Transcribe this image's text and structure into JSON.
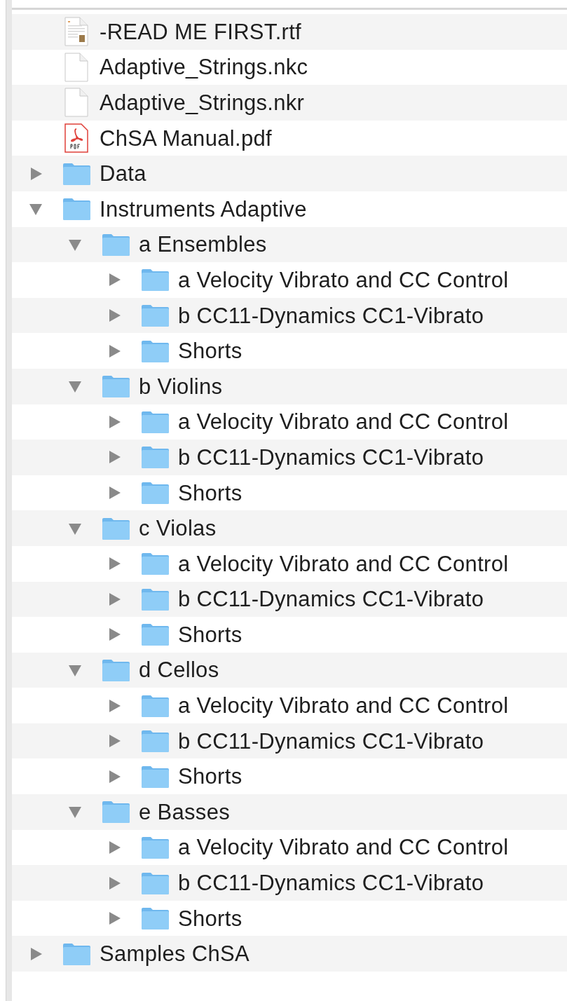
{
  "items": [
    {
      "kind": "rtf",
      "name": "-READ ME FIRST.rtf"
    },
    {
      "kind": "file",
      "name": "Adaptive_Strings.nkc"
    },
    {
      "kind": "file",
      "name": "Adaptive_Strings.nkr"
    },
    {
      "kind": "pdf",
      "name": "ChSA Manual.pdf"
    },
    {
      "kind": "folder",
      "name": "Data",
      "expanded": false
    },
    {
      "kind": "folder",
      "name": "Instruments Adaptive",
      "expanded": true,
      "children": [
        {
          "kind": "folder",
          "name": "a Ensembles",
          "expanded": true,
          "children": [
            {
              "kind": "folder",
              "name": "a Velocity Vibrato and CC Control",
              "expanded": false
            },
            {
              "kind": "folder",
              "name": "b CC11-Dynamics CC1-Vibrato",
              "expanded": false
            },
            {
              "kind": "folder",
              "name": "Shorts",
              "expanded": false
            }
          ]
        },
        {
          "kind": "folder",
          "name": "b Violins",
          "expanded": true,
          "children": [
            {
              "kind": "folder",
              "name": "a Velocity Vibrato and CC Control",
              "expanded": false
            },
            {
              "kind": "folder",
              "name": "b CC11-Dynamics CC1-Vibrato",
              "expanded": false
            },
            {
              "kind": "folder",
              "name": "Shorts",
              "expanded": false
            }
          ]
        },
        {
          "kind": "folder",
          "name": "c Violas",
          "expanded": true,
          "children": [
            {
              "kind": "folder",
              "name": "a Velocity Vibrato and CC Control",
              "expanded": false
            },
            {
              "kind": "folder",
              "name": "b CC11-Dynamics CC1-Vibrato",
              "expanded": false
            },
            {
              "kind": "folder",
              "name": "Shorts",
              "expanded": false
            }
          ]
        },
        {
          "kind": "folder",
          "name": "d Cellos",
          "expanded": true,
          "children": [
            {
              "kind": "folder",
              "name": "a Velocity Vibrato and CC Control",
              "expanded": false
            },
            {
              "kind": "folder",
              "name": "b CC11-Dynamics CC1-Vibrato",
              "expanded": false
            },
            {
              "kind": "folder",
              "name": "Shorts",
              "expanded": false
            }
          ]
        },
        {
          "kind": "folder",
          "name": "e Basses",
          "expanded": true,
          "children": [
            {
              "kind": "folder",
              "name": "a Velocity Vibrato and CC Control",
              "expanded": false
            },
            {
              "kind": "folder",
              "name": "b CC11-Dynamics CC1-Vibrato",
              "expanded": false
            },
            {
              "kind": "folder",
              "name": "Shorts",
              "expanded": false
            }
          ]
        }
      ]
    },
    {
      "kind": "folder",
      "name": "Samples ChSA",
      "expanded": false
    }
  ]
}
